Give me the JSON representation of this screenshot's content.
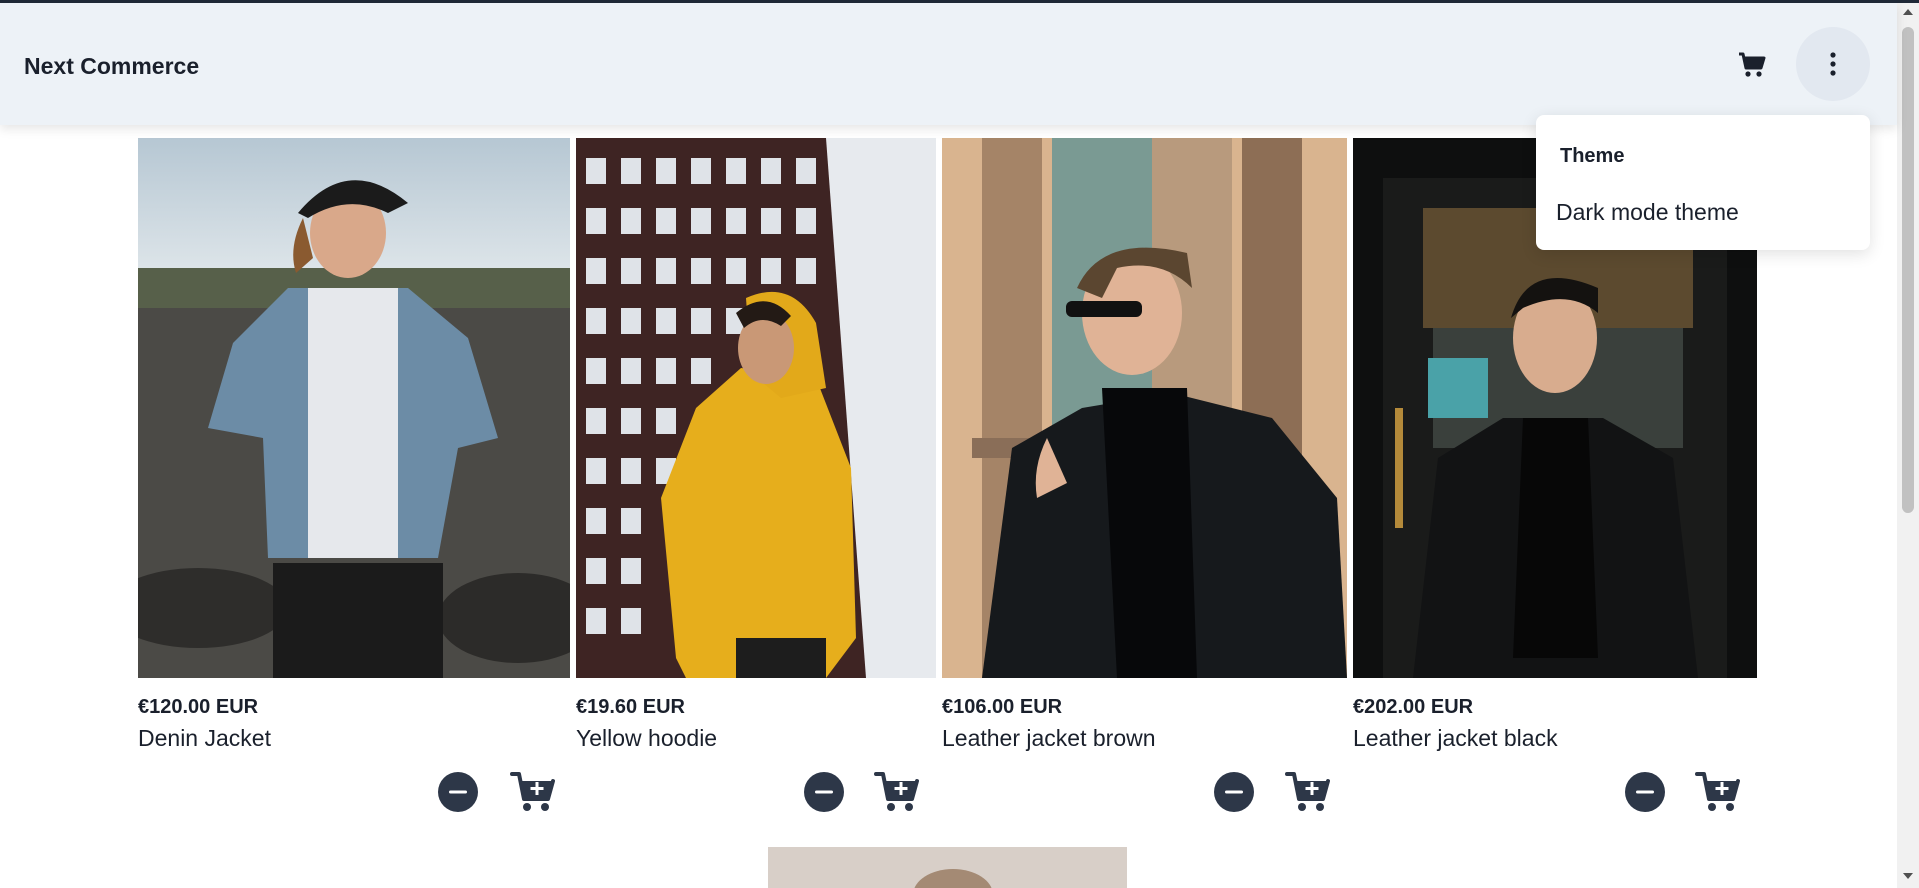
{
  "header": {
    "brand": "Next Commerce",
    "cart_icon": "cart-icon",
    "menu_icon": "more-vertical-icon"
  },
  "theme_menu": {
    "title": "Theme",
    "item": "Dark mode theme"
  },
  "products": [
    {
      "price": "€120.00 EUR",
      "name": "Denin Jacket"
    },
    {
      "price": "€19.60 EUR",
      "name": "Yellow hoodie"
    },
    {
      "price": "€106.00 EUR",
      "name": "Leather jacket brown"
    },
    {
      "price": "€202.00 EUR",
      "name": "Leather jacket black"
    }
  ],
  "colors": {
    "header_bg": "#edf2f7",
    "accent_dark": "#2d3748",
    "text": "#1a202c"
  }
}
